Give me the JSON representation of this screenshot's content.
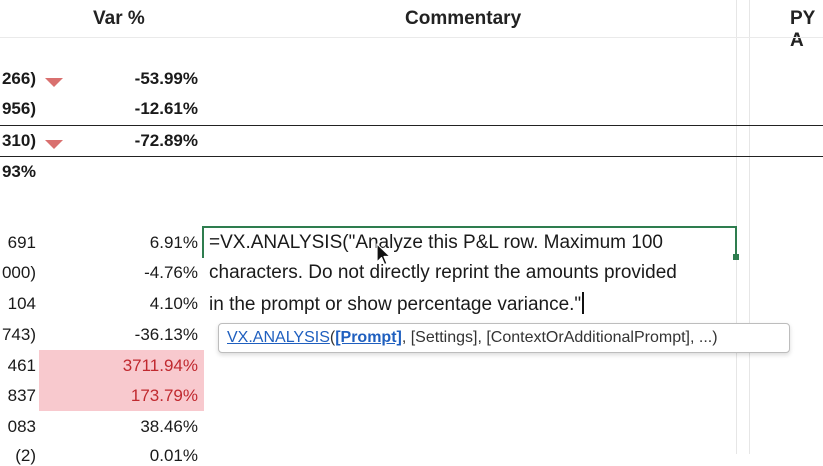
{
  "headers": {
    "var_pct": "Var %",
    "commentary": "Commentary",
    "py": "PY A"
  },
  "rows": [
    {
      "left": "266)",
      "pct": "-53.99%",
      "bold": true,
      "arrow": true
    },
    {
      "left": "956)",
      "pct": "-12.61%",
      "bold": true,
      "arrow": false
    },
    {
      "left": "310)",
      "pct": "-72.89%",
      "bold": true,
      "arrow": true
    },
    {
      "left": "93%",
      "pct": "",
      "bold": true,
      "arrow": false
    },
    {
      "left": "691",
      "pct": "6.91%",
      "bold": false,
      "arrow": false
    },
    {
      "left": "000)",
      "pct": "-4.76%",
      "bold": false,
      "arrow": false
    },
    {
      "left": "104",
      "pct": "4.10%",
      "bold": false,
      "arrow": false
    },
    {
      "left": "743)",
      "pct": "-36.13%",
      "bold": false,
      "arrow": false
    },
    {
      "left": "461",
      "pct": "3711.94%",
      "bold": false,
      "arrow": false,
      "highlight": true
    },
    {
      "left": "837",
      "pct": "173.79%",
      "bold": false,
      "arrow": false,
      "highlight": true
    },
    {
      "left": "083",
      "pct": "38.46%",
      "bold": false,
      "arrow": false
    },
    {
      "left": "(2)",
      "pct": "0.01%",
      "bold": false,
      "arrow": false
    }
  ],
  "formula": {
    "line1": "=VX.ANALYSIS(\"Analyze this P&L row. Maximum 100",
    "line2": "characters. Do not directly reprint the amounts provided",
    "line3": "in the prompt or show percentage variance.\""
  },
  "tooltip": {
    "function_name": "VX.ANALYSIS",
    "open_paren": "(",
    "arg_current": "[Prompt]",
    "rest": ", [Settings], [ContextOrAdditionalPrompt], ...)"
  },
  "colors": {
    "negative_arrow": "#d9706f",
    "highlight_bg": "#f8c9ce",
    "highlight_text": "#c0292f",
    "editor_border": "#2e7d4f",
    "tooltip_link": "#1f5fbf"
  }
}
